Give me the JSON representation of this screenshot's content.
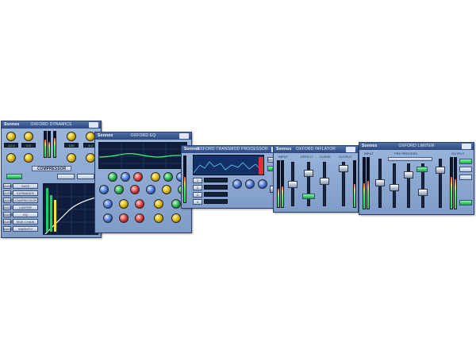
{
  "app": {
    "brand": "Sonnox",
    "panels": [
      {
        "title": "OXFORD DYNAMICS"
      },
      {
        "title": "OXFORD EQ"
      },
      {
        "title": "OXFORD TRANSMOD PROCESSOR"
      },
      {
        "title": "OXFORD INFLATOR"
      },
      {
        "title": "OXFORD LIMITER"
      }
    ]
  },
  "dynamics": {
    "section_label": "COMPRESSOR",
    "side_buttons": [
      "AUDIO",
      "AUDIO",
      "AUDIO",
      "AUDIO",
      "AUDIO",
      "AUDIO",
      "AUDIO",
      "AUDIO"
    ],
    "right_buttons": [
      "GATE",
      "EXPANDER",
      "COMPRESSOR",
      "LIMITER",
      "EQ",
      "SIDE CHAIN",
      "WARMTH"
    ],
    "readouts": [
      "THRESHOLD",
      "ATTACK",
      "RELEASE",
      "RATIO",
      "GAIN"
    ],
    "level_values": [
      "-12.0",
      "0.5",
      "100",
      "4.0",
      "0.0"
    ]
  },
  "eq": {
    "readouts": [
      "LF",
      "LMF",
      "HMF",
      "HF"
    ]
  },
  "transmod": {
    "rows": [
      "1",
      "2",
      "3",
      "4"
    ],
    "buttons": [
      "BYPASS",
      "ON"
    ]
  },
  "inflator": {
    "labels": [
      "INPUT",
      "EFFECT",
      "CURVE",
      "OUTPUT"
    ]
  },
  "limiter": {
    "labels": [
      "INPUT",
      "PRE PROCESS",
      "OUTPUT"
    ]
  },
  "colors": {
    "panel_bg": "#8fa9d3",
    "titlebar": "#2d4a80",
    "lcd_text": "#7ff07f",
    "knob_gold": "#d4b000",
    "button_on": "#1aa84a"
  }
}
